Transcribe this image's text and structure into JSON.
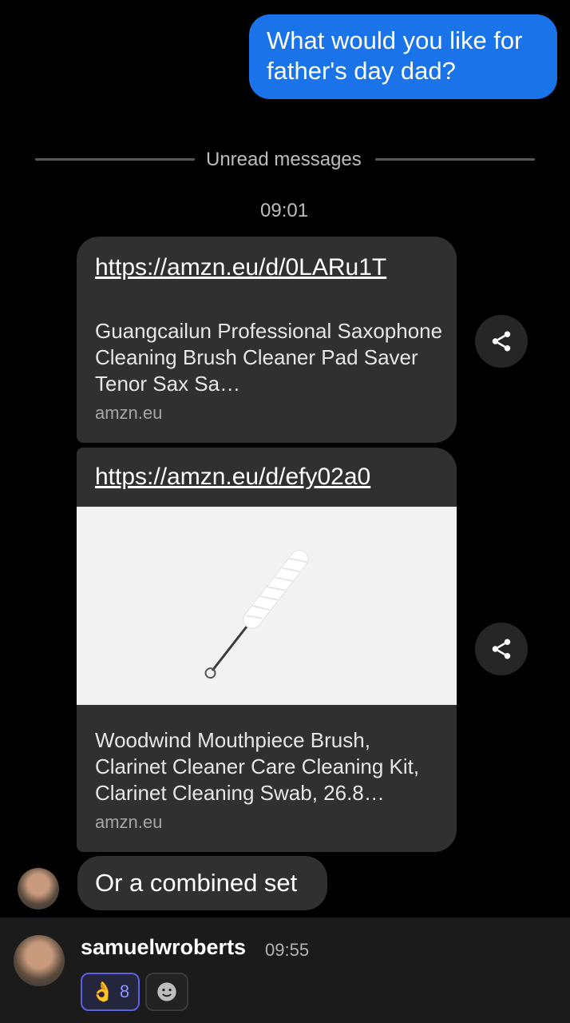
{
  "outgoing": {
    "text": "What would you like for father's day dad?"
  },
  "divider": {
    "label": "Unread messages"
  },
  "time_separator": "09:01",
  "link_cards": [
    {
      "url": "https://amzn.eu/d/0LARu1T",
      "title": "Guangcailun Professional Saxophone Cleaning Brush Cleaner Pad Saver Tenor Sax Sa…",
      "domain": "amzn.eu"
    },
    {
      "url": "https://amzn.eu/d/efy02a0",
      "title": "Woodwind Mouthpiece Brush, Clarinet Cleaner Care Cleaning Kit, Clarinet Cleaning Swab, 26.8…",
      "domain": "amzn.eu",
      "image": "cleaning-brush-product-photo"
    }
  ],
  "incoming_text": "Or a combined set",
  "bottom_message": {
    "username": "samuelwroberts",
    "time": "09:55",
    "reactions": [
      {
        "emoji": "👌",
        "count": "8"
      }
    ]
  },
  "icons": {
    "share": "share-icon",
    "add_reaction": "smiley-icon"
  },
  "colors": {
    "outgoing_bubble": "#1a73e8",
    "incoming_bubble": "#303030",
    "background": "#000000",
    "reaction_accent": "#5a62e0"
  }
}
